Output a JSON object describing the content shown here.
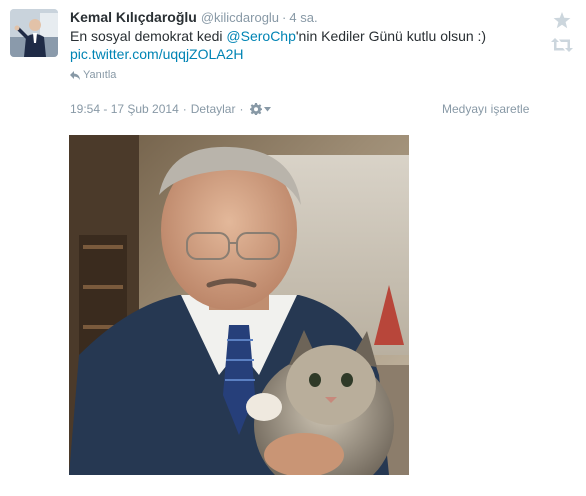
{
  "tweet": {
    "fullname": "Kemal Kılıçdaroğlu",
    "username": "@kilicdaroglu",
    "separator": "·",
    "time_ago": "4 sa.",
    "text_before_mention": "En sosyal demokrat kedi ",
    "mention": "@SeroChp",
    "text_after_mention": "'nin Kediler Günü kutlu olsun :)",
    "link": "pic.twitter.com/uqqjZOLA2H",
    "reply_label": "Yanıtla"
  },
  "meta": {
    "timestamp": "19:54 - 17 Şub 2014",
    "separator": "·",
    "details_label": "Detaylar",
    "flag_media_label": "Medyayı işaretle"
  },
  "icons": {
    "reply": "reply-arrow-icon",
    "favorite": "star-icon",
    "retweet": "retweet-icon",
    "settings": "gear-icon",
    "dropdown": "chevron-down-icon"
  },
  "colors": {
    "link": "#0084b4",
    "text": "#292f33",
    "muted": "#8899a6",
    "icon_gray": "#ccd6dd"
  }
}
